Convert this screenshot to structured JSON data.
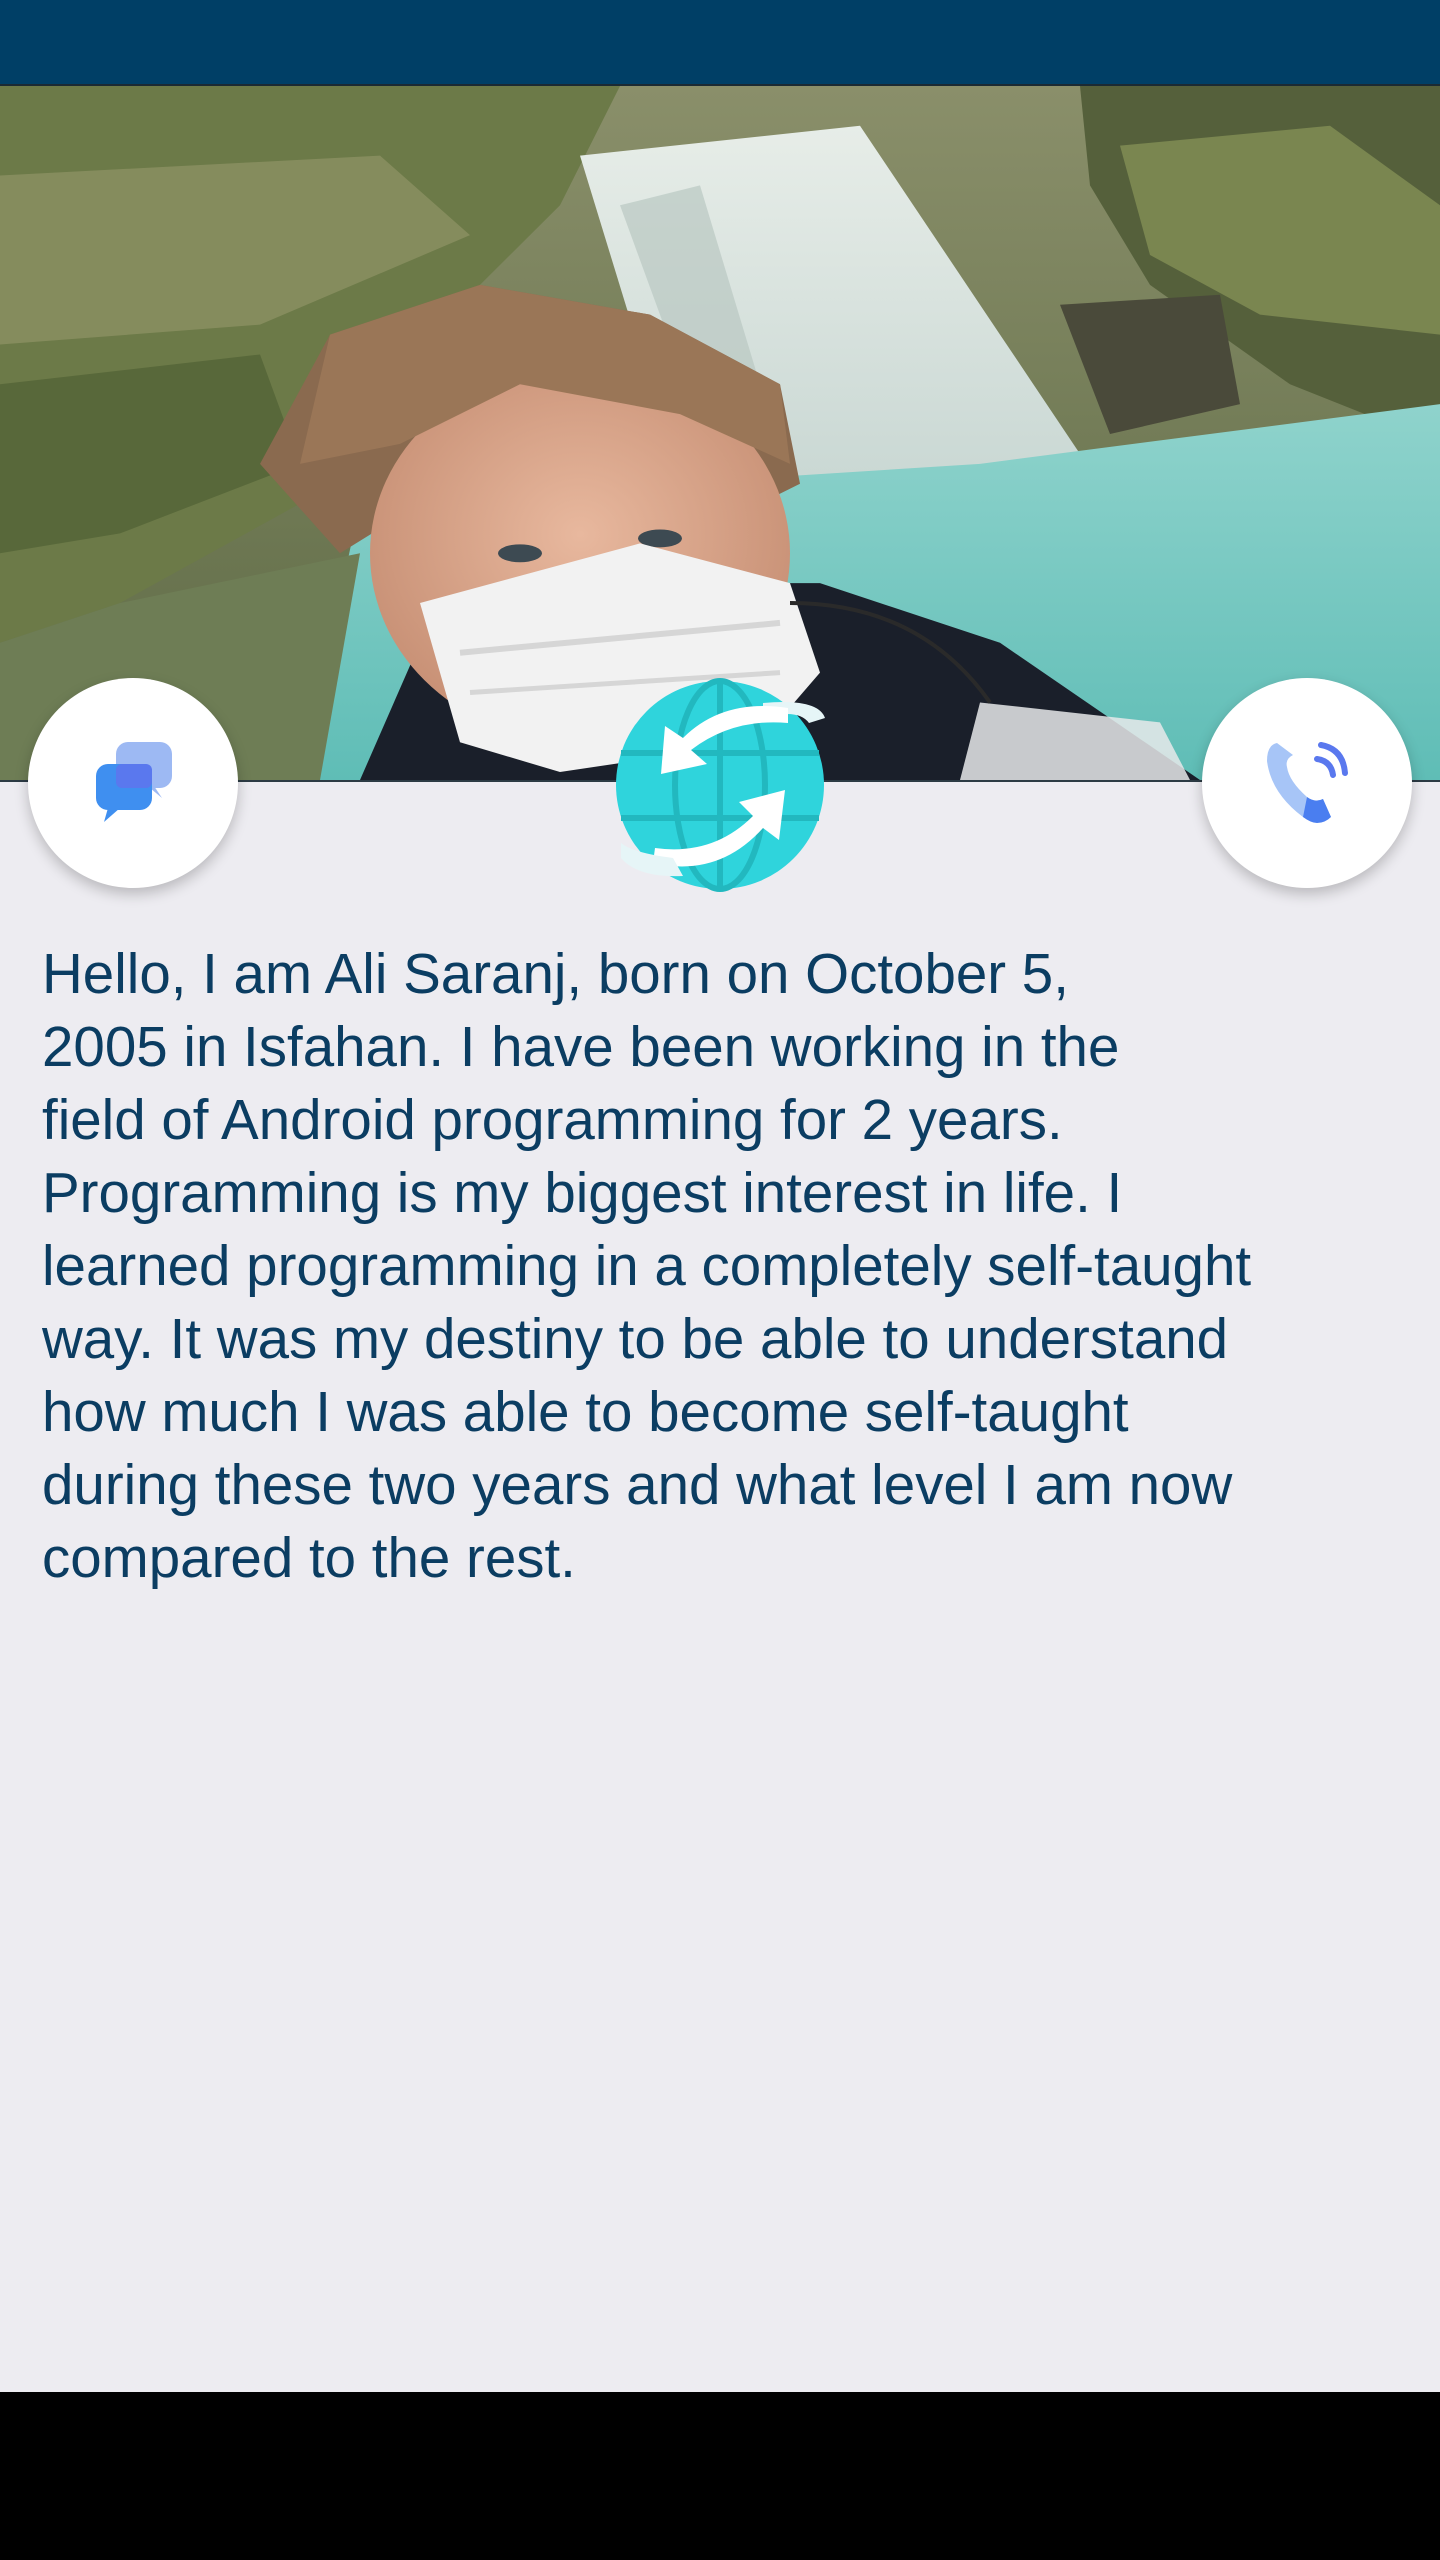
{
  "colors": {
    "status_bar": "#003f66",
    "background": "#edecf1",
    "text": "#0b3d62",
    "nav_bar": "#000000",
    "globe": "#2fd4dc"
  },
  "header": {
    "photo": "profile-photo"
  },
  "actions": {
    "chat": {
      "icon": "chat-bubbles-icon"
    },
    "language": {
      "icon": "globe-translate-icon"
    },
    "call": {
      "icon": "phone-call-icon"
    }
  },
  "bio": {
    "text": "Hello, I am Ali Saranj, born on October 5,\n2005 in Isfahan. I have been working in the\nfield of Android programming for 2 years.\nProgramming is my biggest interest in life. I\nlearned programming in a completely self-taught\nway. It was my destiny to be able to understand\nhow much I was able to become self-taught\nduring these two years and what level I am now\ncompared to the rest."
  }
}
